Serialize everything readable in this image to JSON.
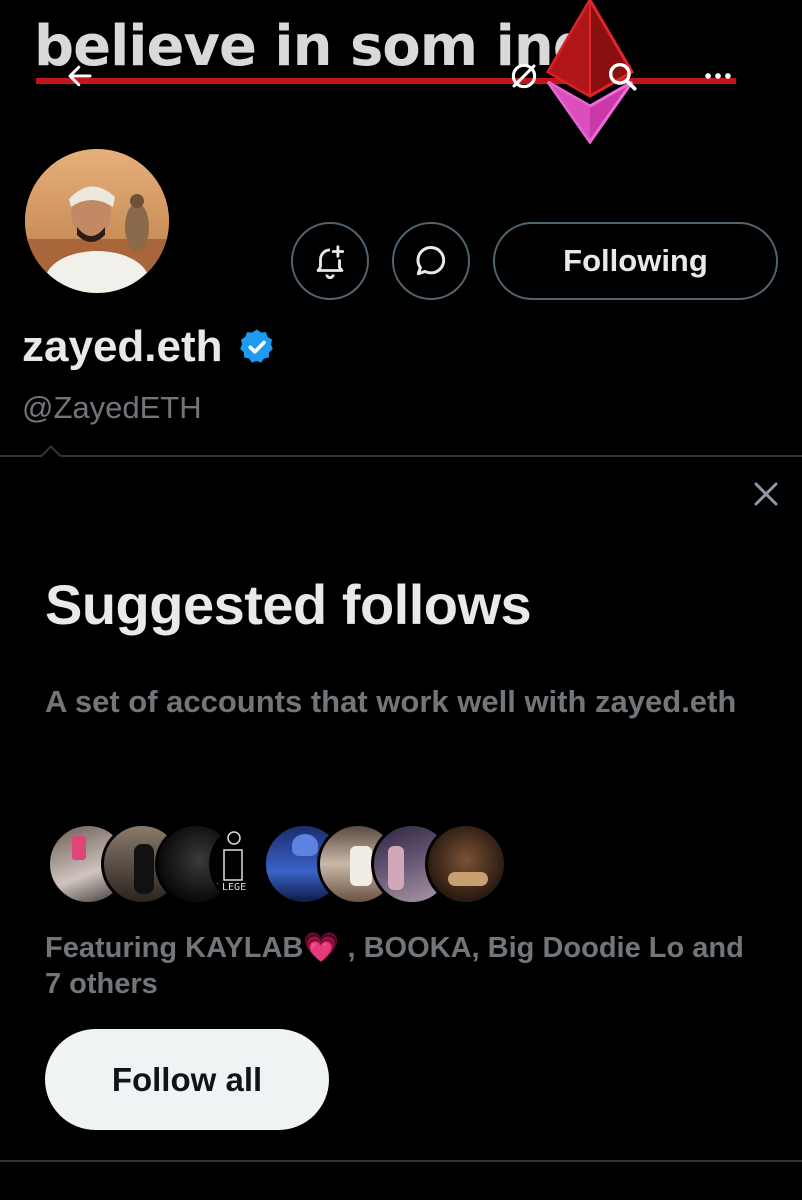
{
  "banner": {
    "text": "believe in som   ing",
    "icons": {
      "back": "arrow-left-icon",
      "link": "link-off-icon",
      "search": "search-icon",
      "more": "more-horizontal-icon"
    }
  },
  "profile": {
    "display_name": "zayed.eth",
    "handle": "@ZayedETH",
    "verified": true,
    "following_label": "Following"
  },
  "suggested": {
    "title": "Suggested follows",
    "description": "A set of accounts that work well with zayed.eth",
    "featuring": "Featuring KAYLAB💗 , BOOKA, Big Doodie Lo and 7 others",
    "follow_all_label": "Follow all",
    "avatar_count": 8
  },
  "colors": {
    "background": "#000000",
    "text_primary": "#e7e9ea",
    "text_secondary": "#71767b",
    "border": "#536471",
    "verified_blue": "#1d9bf0",
    "banner_red": "#c2161b"
  }
}
